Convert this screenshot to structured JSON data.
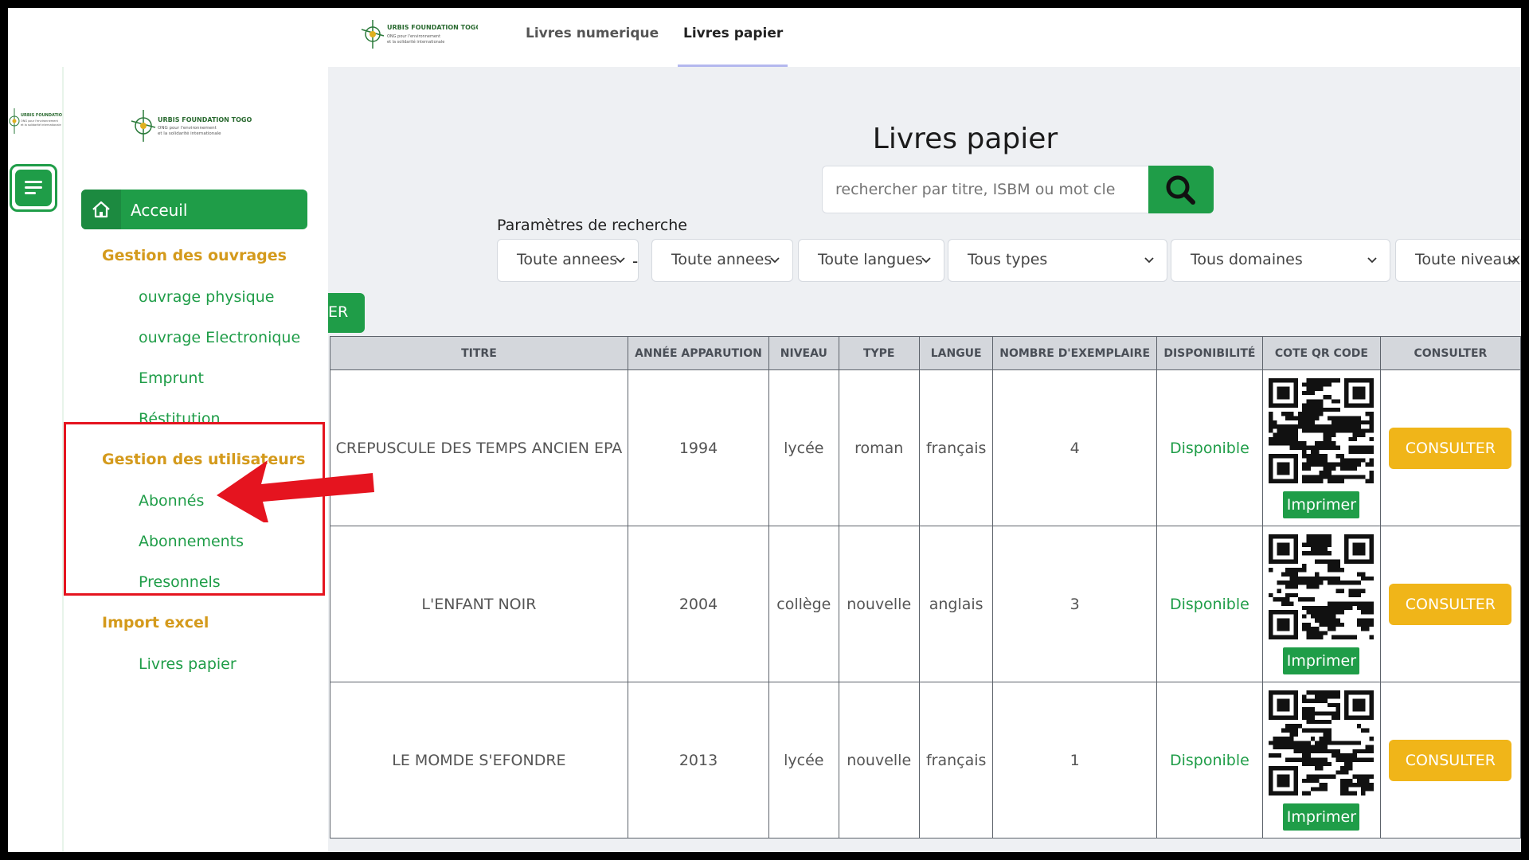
{
  "org": {
    "name": "URBIS FOUNDATION TOGO",
    "tagline_line1": "ONG pour l'environnement",
    "tagline_line2": "et la solidarité internationale"
  },
  "header": {
    "tabs": [
      {
        "label": "Livres numerique"
      },
      {
        "label": "Livres papier"
      }
    ]
  },
  "sidebar": {
    "home_label": "Acceuil",
    "sections": [
      {
        "title": "Gestion des ouvrages",
        "items": [
          "ouvrage physique",
          "ouvrage Electronique",
          "Emprunt",
          "Réstitution"
        ]
      },
      {
        "title": "Gestion des utilisateurs",
        "items": [
          "Abonnés",
          "Abonnements",
          "Presonnels"
        ]
      },
      {
        "title": "Import excel",
        "items": [
          "Livres papier"
        ]
      }
    ]
  },
  "main": {
    "title": "Livres papier",
    "search": {
      "placeholder": "rechercher par titre, ISBM ou mot cle"
    },
    "params_label": "Paramètres de recherche",
    "filters": [
      "Toute annees",
      "Toute annees",
      "Toute langues",
      "Tous types",
      "Tous domaines",
      "Toute niveaux"
    ],
    "chip_label": "ER",
    "table": {
      "headers": [
        "TITRE",
        "ANNÉE APPARUTION",
        "NIVEAU",
        "TYPE",
        "LANGUE",
        "NOMBRE D'EXEMPLAIRE",
        "DISPONIBILITÉ",
        "COTE QR CODE",
        "CONSULTER"
      ],
      "rows": [
        {
          "titre": "CREPUSCULE DES TEMPS ANCIEN EPA",
          "annee": "1994",
          "niveau": "lycée",
          "type": "roman",
          "langue": "français",
          "nombre": "4",
          "dispo": "Disponible",
          "print": "Imprimer",
          "consult": "CONSULTER"
        },
        {
          "titre": "L'ENFANT NOIR",
          "annee": "2004",
          "niveau": "collège",
          "type": "nouvelle",
          "langue": "anglais",
          "nombre": "3",
          "dispo": "Disponible",
          "print": "Imprimer",
          "consult": "CONSULTER"
        },
        {
          "titre": "LE MOMDE S'EFONDRE",
          "annee": "2013",
          "niveau": "lycée",
          "type": "nouvelle",
          "langue": "français",
          "nombre": "1",
          "dispo": "Disponible",
          "print": "Imprimer",
          "consult": "CONSULTER"
        }
      ]
    }
  },
  "colors": {
    "primary_green": "#1f9d48",
    "section_gold": "#d49a1c",
    "consult_yellow": "#f0b519",
    "annotation_red": "#e5141f"
  }
}
